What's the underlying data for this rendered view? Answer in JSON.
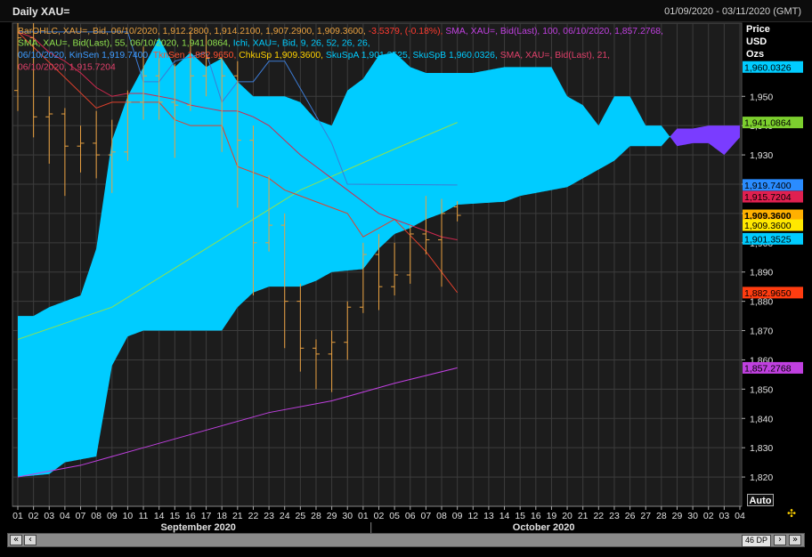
{
  "window": {
    "title": "Daily XAU=",
    "date_range": "01/09/2020 - 03/11/2020 (GMT)"
  },
  "colors": {
    "background": "#000000",
    "plot_bg": "#1c1c1c",
    "grid": "#3c3c3c",
    "cloud_bull": "#00ccff",
    "cloud_bear": "#7a3cff",
    "bars": "#e8a040",
    "sma21": "#d0284e",
    "sma55": "#8fe24e",
    "sma100": "#c040e0",
    "kijun": "#3c7bd4",
    "tenkan": "#e0402c"
  },
  "header": {
    "lines": [
      [
        {
          "t": "BarOHLC, XAU=, Bid, 06/10/2020, 1,912.2800, 1,914.2100, 1,907.2900, 1,909.3600, ",
          "c": "#e8a040"
        },
        {
          "t": "-3.5379, (-0.18%), ",
          "c": "#ff3b30"
        },
        {
          "t": "SMA, XAU=, Bid(Last), 100, 06/10/2020, 1,857.2768,",
          "c": "#c040e0"
        }
      ],
      [
        {
          "t": "SMA, XAU=, Bid(Last), 55, 06/10/2020, 1,941.0864, ",
          "c": "#8fe24e"
        },
        {
          "t": "Ichi, XAU=, Bid, 9, 26, 52, 26, 26,",
          "c": "#00ccff"
        }
      ],
      [
        {
          "t": "06/10/2020, ",
          "c": "#3c9bff"
        },
        {
          "t": "KinSen 1,919.7400, ",
          "c": "#3c9bff"
        },
        {
          "t": "TknSen 1,882.9650, ",
          "c": "#ff5030"
        },
        {
          "t": "ChkuSp 1,909.3600, ",
          "c": "#ffd200"
        },
        {
          "t": "SkuSpA 1,901.3525, SkuSpB 1,960.0326, ",
          "c": "#00ccff"
        },
        {
          "t": "SMA, XAU=, Bid(Last), 21,",
          "c": "#e0406a"
        }
      ],
      [
        {
          "t": "06/10/2020, 1,915.7204",
          "c": "#e0406a"
        }
      ]
    ]
  },
  "axis_header": {
    "price": "Price",
    "currency": "USD",
    "unit": "Ozs"
  },
  "value_tags": [
    {
      "text": "1,960.0326",
      "value": 1960.0326,
      "bg": "#00ccff",
      "fg": "#000000"
    },
    {
      "text": "1,941.0864",
      "value": 1941.0864,
      "bg": "#7ccf2e",
      "fg": "#000000"
    },
    {
      "text": "1,919.7400",
      "value": 1919.74,
      "bg": "#2a8cff",
      "fg": "#000000"
    },
    {
      "text": "1,915.7204",
      "value": 1915.7204,
      "bg": "#e02050",
      "fg": "#000000"
    },
    {
      "text": "1,909.3600",
      "value": 1909.36,
      "bg": "#ffb000",
      "fg": "#000000"
    },
    {
      "text": "1,909.3600",
      "value": 1906.0,
      "bg": "#ffe800",
      "fg": "#000000"
    },
    {
      "text": "1,901.3525",
      "value": 1901.3525,
      "bg": "#00ccff",
      "fg": "#000000"
    },
    {
      "text": "1,882.9650",
      "value": 1882.965,
      "bg": "#ff3c10",
      "fg": "#000000"
    },
    {
      "text": "1,857.2768",
      "value": 1857.2768,
      "bg": "#c040e0",
      "fg": "#000000"
    }
  ],
  "footer": {
    "auto_label": "Auto",
    "months": [
      {
        "label": "September 2020",
        "at": 11.5
      },
      {
        "label": "October 2020",
        "at": 33.5
      }
    ],
    "month_divider_at": 22.5,
    "scroll": {
      "first": "«",
      "prev": "‹",
      "next": "›",
      "last": "»",
      "dp_label": "46 DP"
    }
  },
  "chart_data": {
    "type": "candlestick",
    "title": "Daily XAU=",
    "ylim": [
      1810,
      1975
    ],
    "y_ticks": [
      1820,
      1830,
      1840,
      1850,
      1860,
      1870,
      1880,
      1890,
      1900,
      1910,
      1920,
      1930,
      1940,
      1950
    ],
    "x_labels": [
      "01",
      "02",
      "03",
      "04",
      "07",
      "08",
      "09",
      "10",
      "11",
      "14",
      "15",
      "16",
      "17",
      "18",
      "21",
      "22",
      "23",
      "24",
      "25",
      "28",
      "29",
      "30",
      "01",
      "02",
      "05",
      "06",
      "07",
      "08",
      "09",
      "12",
      "13",
      "14",
      "15",
      "16",
      "19",
      "20",
      "21",
      "22",
      "23",
      "26",
      "27",
      "28",
      "29",
      "30",
      "02",
      "03",
      "04"
    ],
    "bars": [
      {
        "o": 1952,
        "h": 1992,
        "l": 1945,
        "c": 1970
      },
      {
        "o": 1970,
        "h": 1975,
        "l": 1936,
        "c": 1943
      },
      {
        "o": 1943,
        "h": 1950,
        "l": 1927,
        "c": 1944
      },
      {
        "o": 1944,
        "h": 1946,
        "l": 1916,
        "c": 1933
      },
      {
        "o": 1933,
        "h": 1940,
        "l": 1924,
        "c": 1934
      },
      {
        "o": 1934,
        "h": 1945,
        "l": 1922,
        "c": 1930
      },
      {
        "o": 1930,
        "h": 1942,
        "l": 1917,
        "c": 1931
      },
      {
        "o": 1931,
        "h": 1952,
        "l": 1928,
        "c": 1948
      },
      {
        "o": 1948,
        "h": 1967,
        "l": 1942,
        "c": 1957
      },
      {
        "o": 1957,
        "h": 1963,
        "l": 1942,
        "c": 1948
      },
      {
        "o": 1948,
        "h": 1961,
        "l": 1929,
        "c": 1947
      },
      {
        "o": 1947,
        "h": 1972,
        "l": 1945,
        "c": 1957
      },
      {
        "o": 1957,
        "h": 1971,
        "l": 1950,
        "c": 1963
      },
      {
        "o": 1963,
        "h": 1963,
        "l": 1931,
        "c": 1957
      },
      {
        "o": 1957,
        "h": 1962,
        "l": 1912,
        "c": 1935
      },
      {
        "o": 1935,
        "h": 1940,
        "l": 1882,
        "c": 1900
      },
      {
        "o": 1900,
        "h": 1923,
        "l": 1897,
        "c": 1906
      },
      {
        "o": 1906,
        "h": 1910,
        "l": 1864,
        "c": 1880
      },
      {
        "o": 1880,
        "h": 1886,
        "l": 1856,
        "c": 1864
      },
      {
        "o": 1864,
        "h": 1867,
        "l": 1850,
        "c": 1862
      },
      {
        "o": 1862,
        "h": 1870,
        "l": 1849,
        "c": 1866
      },
      {
        "o": 1866,
        "h": 1880,
        "l": 1860,
        "c": 1878
      },
      {
        "o": 1878,
        "h": 1900,
        "l": 1876,
        "c": 1896
      },
      {
        "o": 1896,
        "h": 1903,
        "l": 1877,
        "c": 1885
      },
      {
        "o": 1885,
        "h": 1900,
        "l": 1882,
        "c": 1889
      },
      {
        "o": 1889,
        "h": 1906,
        "l": 1886,
        "c": 1903
      },
      {
        "o": 1903,
        "h": 1916,
        "l": 1896,
        "c": 1901
      },
      {
        "o": 1901,
        "h": 1915,
        "l": 1885,
        "c": 1910
      },
      {
        "o": 1912.28,
        "h": 1914.21,
        "l": 1907.29,
        "c": 1909.36
      }
    ],
    "sma21": [
      1972,
      1970,
      1965,
      1962,
      1958,
      1953,
      1950,
      1951,
      1951,
      1950,
      1949,
      1947,
      1946,
      1945,
      1945,
      1943,
      1940,
      1935,
      1930,
      1926,
      1922,
      1918,
      1914,
      1910,
      1908,
      1906,
      1904,
      1902,
      1901
    ],
    "sma55": [
      [
        0,
        1867
      ],
      [
        6,
        1878
      ],
      [
        12,
        1898
      ],
      [
        18,
        1918
      ],
      [
        24,
        1932
      ],
      [
        28,
        1941.0864
      ]
    ],
    "sma100": [
      [
        0,
        1820
      ],
      [
        4,
        1824
      ],
      [
        8,
        1830
      ],
      [
        12,
        1836
      ],
      [
        16,
        1842
      ],
      [
        20,
        1846
      ],
      [
        24,
        1852
      ],
      [
        28,
        1857.2768
      ]
    ],
    "kijun": [
      [
        0,
        1972
      ],
      [
        7,
        1972
      ],
      [
        8,
        1955
      ],
      [
        9,
        1955
      ],
      [
        10,
        1962
      ],
      [
        12,
        1965
      ],
      [
        13,
        1948
      ],
      [
        14,
        1955
      ],
      [
        15,
        1955
      ],
      [
        16,
        1962
      ],
      [
        17,
        1962
      ],
      [
        20,
        1934
      ],
      [
        21,
        1920
      ],
      [
        28,
        1919.74
      ]
    ],
    "tenkan": [
      [
        0,
        1972
      ],
      [
        5,
        1946
      ],
      [
        6,
        1948
      ],
      [
        9,
        1948
      ],
      [
        10,
        1942
      ],
      [
        11,
        1940
      ],
      [
        13,
        1940
      ],
      [
        14,
        1926
      ],
      [
        16,
        1922
      ],
      [
        17,
        1918
      ],
      [
        19,
        1914
      ],
      [
        21,
        1910
      ],
      [
        22,
        1902
      ],
      [
        24,
        1908
      ],
      [
        26,
        1897
      ],
      [
        28,
        1882.965
      ]
    ],
    "senkou_a": [
      [
        0,
        1820
      ],
      [
        2,
        1821
      ],
      [
        3,
        1825
      ],
      [
        4,
        1826
      ],
      [
        5,
        1827
      ],
      [
        6,
        1858
      ],
      [
        7,
        1868
      ],
      [
        8,
        1870
      ],
      [
        13,
        1870
      ],
      [
        14,
        1878
      ],
      [
        15,
        1883
      ],
      [
        16,
        1885
      ],
      [
        18,
        1885
      ],
      [
        19,
        1887
      ],
      [
        20,
        1890
      ],
      [
        22,
        1891
      ],
      [
        23,
        1898
      ],
      [
        24,
        1903
      ],
      [
        25,
        1905
      ],
      [
        26,
        1908
      ],
      [
        27,
        1910
      ],
      [
        28,
        1913
      ],
      [
        31,
        1914
      ],
      [
        32,
        1916
      ],
      [
        34,
        1918
      ],
      [
        35,
        1919
      ],
      [
        37,
        1925
      ],
      [
        38,
        1928
      ],
      [
        39,
        1933
      ],
      [
        40,
        1933
      ],
      [
        41,
        1933
      ],
      [
        42,
        1939
      ],
      [
        43,
        1939
      ],
      [
        44,
        1940
      ],
      [
        45,
        1940
      ],
      [
        46,
        1940
      ]
    ],
    "senkou_b": [
      [
        0,
        1875
      ],
      [
        1,
        1875
      ],
      [
        2,
        1878
      ],
      [
        3,
        1880
      ],
      [
        4,
        1882
      ],
      [
        5,
        1898
      ],
      [
        6,
        1935
      ],
      [
        7,
        1950
      ],
      [
        8,
        1960
      ],
      [
        9,
        1970
      ],
      [
        10,
        1960
      ],
      [
        11,
        1965
      ],
      [
        12,
        1960
      ],
      [
        13,
        1963
      ],
      [
        14,
        1955
      ],
      [
        15,
        1950
      ],
      [
        16,
        1950
      ],
      [
        17,
        1950
      ],
      [
        18,
        1948
      ],
      [
        19,
        1942
      ],
      [
        20,
        1940
      ],
      [
        21,
        1952
      ],
      [
        22,
        1956
      ],
      [
        23,
        1964
      ],
      [
        24,
        1965
      ],
      [
        25,
        1960
      ],
      [
        26,
        1958
      ],
      [
        27,
        1958
      ],
      [
        28,
        1958
      ],
      [
        29,
        1958
      ],
      [
        31,
        1960
      ],
      [
        32,
        1960
      ],
      [
        33,
        1960
      ],
      [
        34,
        1960
      ],
      [
        35,
        1950
      ],
      [
        36,
        1947
      ],
      [
        37,
        1940
      ],
      [
        38,
        1950
      ],
      [
        39,
        1950
      ],
      [
        40,
        1940
      ],
      [
        41,
        1940
      ],
      [
        42,
        1933
      ],
      [
        43,
        1934
      ],
      [
        44,
        1934
      ],
      [
        45,
        1930
      ],
      [
        46,
        1936
      ]
    ]
  }
}
